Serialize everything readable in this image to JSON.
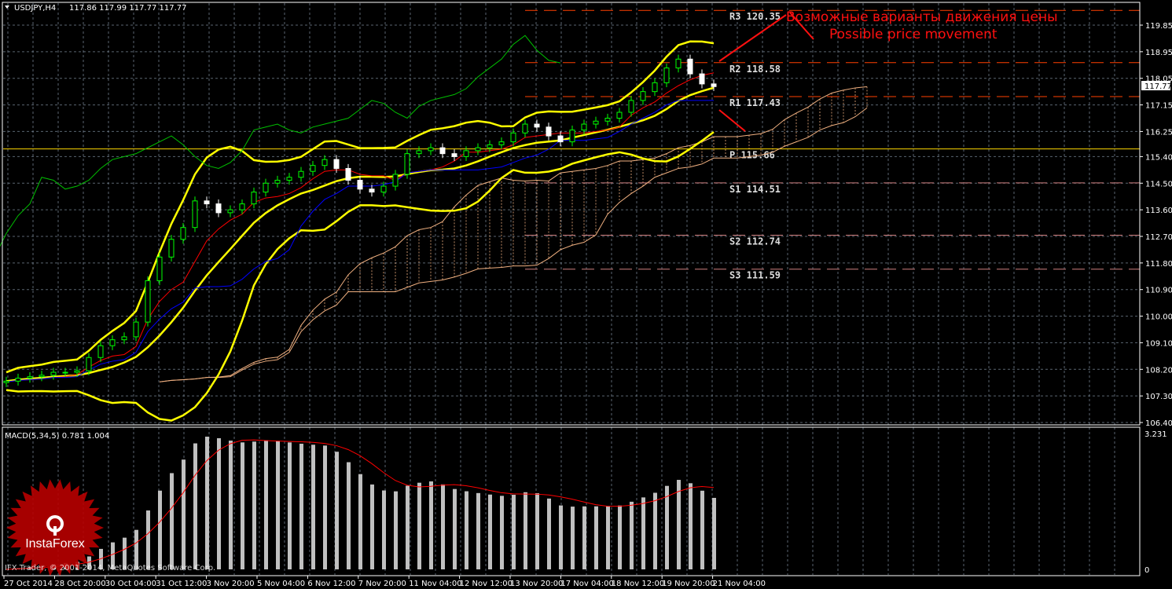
{
  "header": {
    "symbol": "USDJPY,H4",
    "ohlc": "117.86 117.99 117.77 117.77",
    "current_price": "117.77"
  },
  "macd_panel": {
    "label": "MACD(5,34,5) 0.781 1.004",
    "axis_max": "3.231",
    "axis_min": "0"
  },
  "annotation": {
    "line1": "Возможные варианты движения цены",
    "line2": "Possible price movement",
    "color": "#ff1010"
  },
  "copyright": "IFX Trader, © 2001-2014, MetaQuotes Software Corp.",
  "logo": {
    "text": "InstaForex",
    "color": "#b80000"
  },
  "colors": {
    "background": "#000000",
    "bull": "#00ff00",
    "bear": "#ffffff",
    "tenkan": "#ff0000",
    "kijun": "#0000ff",
    "chikou": "#00c000",
    "bands": "#ffff00",
    "cloud": "#f0b080",
    "resistance": "#ff4000",
    "pivot": "#ffd700",
    "support": "#d08080",
    "grid": "#8090a0"
  },
  "chart_data": {
    "type": "candlestick",
    "title": "USDJPY,H4",
    "y_ticks": [
      "119.85",
      "118.95",
      "118.05",
      "117.15",
      "116.25",
      "115.40",
      "114.50",
      "113.60",
      "112.70",
      "111.80",
      "110.90",
      "110.00",
      "109.10",
      "108.20",
      "107.30",
      "106.40"
    ],
    "ylim": [
      106.4,
      119.85
    ],
    "x_labels": [
      "27 Oct 2014",
      "28 Oct 20:00",
      "30 Oct 04:00",
      "31 Oct 12:00",
      "3 Nov 20:00",
      "5 Nov 04:00",
      "6 Nov 12:00",
      "7 Nov 20:00",
      "11 Nov 04:00",
      "12 Nov 12:00",
      "13 Nov 20:00",
      "17 Nov 04:00",
      "18 Nov 12:00",
      "19 Nov 20:00",
      "21 Nov 04:00"
    ],
    "close": [
      107.8,
      107.9,
      107.95,
      108.0,
      108.1,
      108.1,
      108.15,
      108.6,
      109.0,
      109.2,
      109.3,
      109.8,
      111.2,
      112.0,
      112.6,
      113.0,
      113.9,
      113.8,
      113.5,
      113.6,
      113.8,
      114.2,
      114.5,
      114.6,
      114.7,
      114.9,
      115.1,
      115.3,
      115.0,
      114.6,
      114.3,
      114.2,
      114.4,
      114.8,
      115.5,
      115.6,
      115.7,
      115.5,
      115.4,
      115.6,
      115.7,
      115.8,
      115.9,
      116.2,
      116.5,
      116.4,
      116.1,
      115.9,
      116.3,
      116.5,
      116.6,
      116.7,
      116.9,
      117.3,
      117.6,
      117.9,
      118.4,
      118.7,
      118.2,
      117.86,
      117.77
    ],
    "pivots": [
      {
        "label": "R3 120.35",
        "value": 120.35,
        "kind": "resistance"
      },
      {
        "label": "R2 118.58",
        "value": 118.58,
        "kind": "resistance"
      },
      {
        "label": "R1 117.43",
        "value": 117.43,
        "kind": "resistance"
      },
      {
        "label": "P 115.66",
        "value": 115.66,
        "kind": "pivot"
      },
      {
        "label": "S1 114.51",
        "value": 114.51,
        "kind": "support"
      },
      {
        "label": "S2 112.74",
        "value": 112.74,
        "kind": "support"
      },
      {
        "label": "S3 111.59",
        "value": 111.59,
        "kind": "support"
      }
    ],
    "macd": {
      "fast": 5,
      "slow": 34,
      "signal": 5,
      "ylim": [
        0,
        3.231
      ]
    },
    "grid": true
  }
}
